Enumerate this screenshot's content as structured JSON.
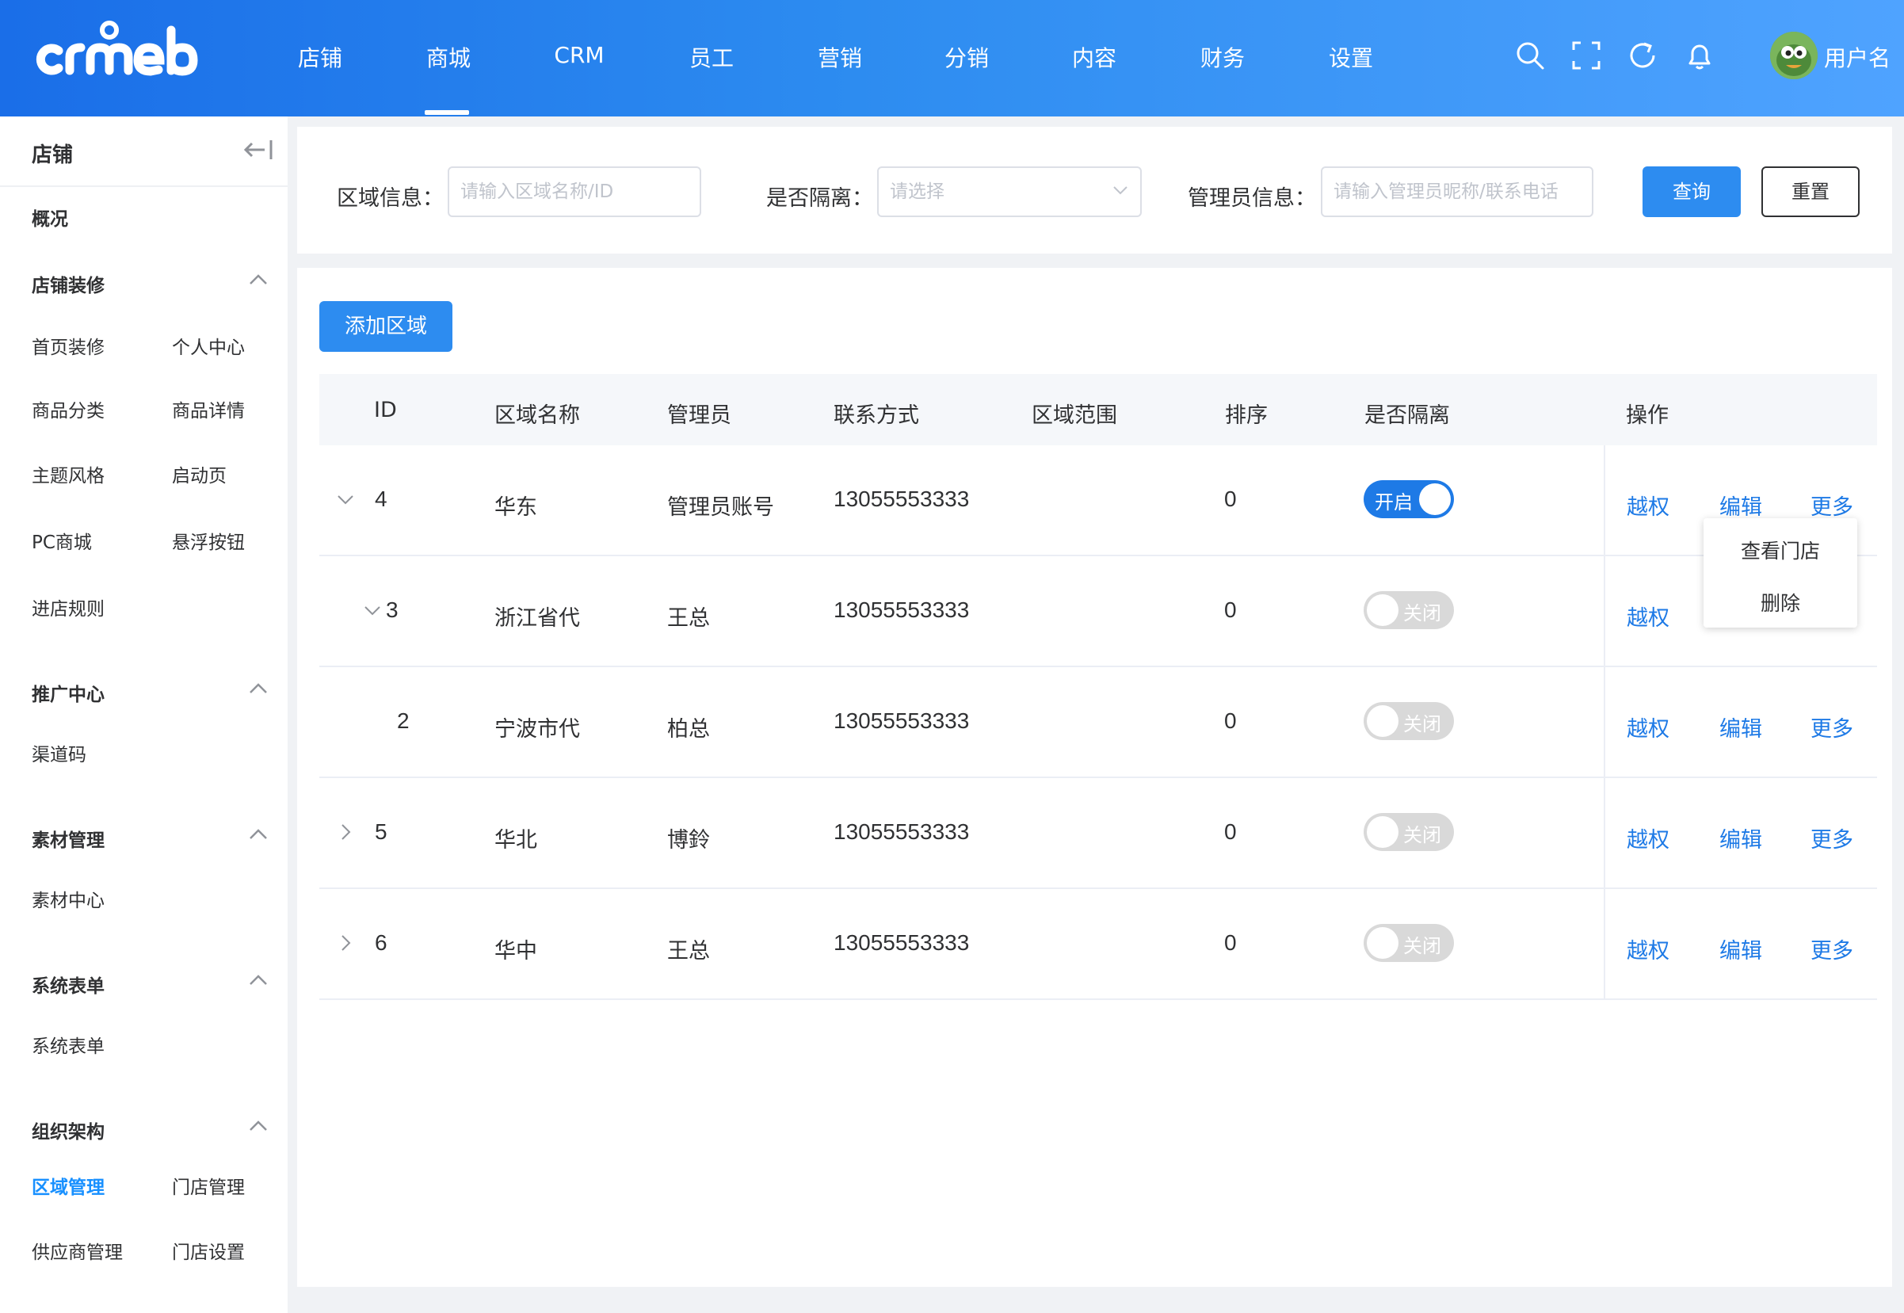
{
  "brand": {
    "logo_text": "crmeb"
  },
  "header": {
    "nav": [
      "店铺",
      "商城",
      "CRM",
      "员工",
      "营销",
      "分销",
      "内容",
      "财务",
      "设置"
    ],
    "active_nav": "商城",
    "icons": [
      "search-icon",
      "fullscreen-icon",
      "refresh-icon",
      "bell-icon"
    ],
    "username": "用户名"
  },
  "sidebar": {
    "title": "店铺",
    "overview": "概况",
    "groups": [
      {
        "title": "店铺装修",
        "items": [
          "首页装修",
          "个人中心",
          "商品分类",
          "商品详情",
          "主题风格",
          "启动页",
          "PC商城",
          "悬浮按钮",
          "进店规则"
        ]
      },
      {
        "title": "推广中心",
        "items": [
          "渠道码"
        ]
      },
      {
        "title": "素材管理",
        "items": [
          "素材中心"
        ]
      },
      {
        "title": "系统表单",
        "items": [
          "系统表单"
        ]
      },
      {
        "title": "组织架构",
        "items": [
          "区域管理",
          "门店管理",
          "供应商管理",
          "门店设置"
        ]
      }
    ],
    "active_item": "区域管理"
  },
  "filter": {
    "area_label": "区域信息：",
    "area_placeholder": "请输入区域名称/ID",
    "isolation_label": "是否隔离：",
    "isolation_placeholder": "请选择",
    "admin_label": "管理员信息：",
    "admin_placeholder": "请输入管理员昵称/联系电话",
    "query_button": "查询",
    "reset_button": "重置"
  },
  "toolbar": {
    "add_button": "添加区域"
  },
  "table": {
    "columns": [
      "ID",
      "区域名称",
      "管理员",
      "联系方式",
      "区域范围",
      "排序",
      "是否隔离",
      "操作"
    ],
    "rows": [
      {
        "id": "4",
        "name": "华东",
        "admin": "管理员账号",
        "phone": "13055553333",
        "range": "",
        "sort": "0",
        "isolated": true,
        "switch_text": "开启",
        "expand": "expanded"
      },
      {
        "id": "3",
        "name": "浙江省代",
        "admin": "王总",
        "phone": "13055553333",
        "range": "",
        "sort": "0",
        "isolated": false,
        "switch_text": "关闭",
        "expand": "expanded"
      },
      {
        "id": "2",
        "name": "宁波市代",
        "admin": "柏总",
        "phone": "13055553333",
        "range": "",
        "sort": "0",
        "isolated": false,
        "switch_text": "关闭",
        "expand": "none"
      },
      {
        "id": "5",
        "name": "华北",
        "admin": "博鈴",
        "phone": "13055553333",
        "range": "",
        "sort": "0",
        "isolated": false,
        "switch_text": "关闭",
        "expand": "collapsed"
      },
      {
        "id": "6",
        "name": "华中",
        "admin": "王总",
        "phone": "13055553333",
        "range": "",
        "sort": "0",
        "isolated": false,
        "switch_text": "关闭",
        "expand": "collapsed"
      }
    ],
    "actions": {
      "override": "越权",
      "edit": "编辑",
      "more": "更多"
    }
  },
  "more_menu": {
    "items": [
      "查看门店",
      "删除"
    ]
  },
  "colors": {
    "primary": "#2d8cf0",
    "link": "#1e7ae6",
    "switch_off": "#d9d9d9"
  }
}
